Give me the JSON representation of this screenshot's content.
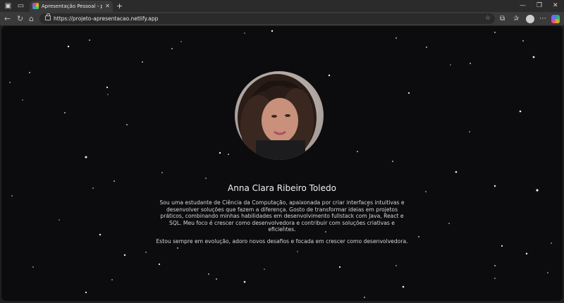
{
  "browser": {
    "tab": {
      "title": "Apresentação Pessoal - projeto fi",
      "close": "✕"
    },
    "new_tab": "+",
    "window_controls": {
      "minimize": "—",
      "restore": "❐",
      "close": "✕"
    },
    "nav": {
      "back": "←",
      "reload": "↻",
      "home": "⌂"
    },
    "address": {
      "url": "https://projeto-apresentacao.netlify.app"
    },
    "toolbar_icons": {
      "favorite": "☆",
      "extensions": "⧉",
      "favorites_bar": "✰",
      "more": "⋯"
    }
  },
  "profile": {
    "name": "Anna Clara Ribeiro Toledo",
    "paragraphs": [
      "Sou uma estudante de Ciência da Computação, apaixonada por criar interfaces intuitivas e desenvolver soluções que fazem a diferença. Gosto de transformar ideias em projetos práticos, combinando minhas habilidades em desenvolvimento fullstack com Java, React e SQL. Meu foco é crescer como desenvolvedora e contribuir com soluções criativas e eficientes.",
      "Estou sempre em evolução, adoro novos desafios e focada em crescer como desenvolvedora."
    ]
  },
  "colors": {
    "background": "#0c0b0e",
    "text": "#f2f2f2",
    "star": "#ffffff"
  }
}
